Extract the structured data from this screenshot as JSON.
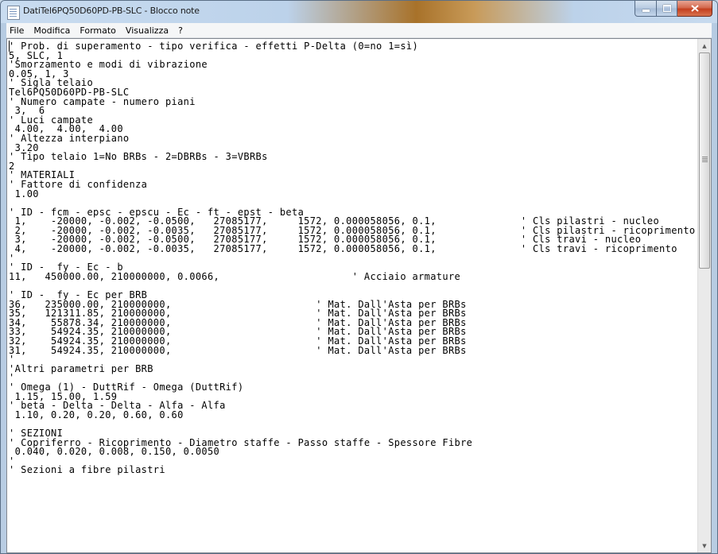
{
  "window": {
    "title": "DatiTel6PQ50D60PD-PB-SLC - Blocco note"
  },
  "menu": {
    "items": [
      "File",
      "Modifica",
      "Formato",
      "Visualizza",
      "?"
    ]
  },
  "editor": {
    "text": "' Prob. di superamento - tipo verifica - effetti P-Delta (0=no 1=sì)\n5, SLC, 1\n'Smorzamento e modi di vibrazione\n0.05, 1, 3\n' Sigla telaio\nTel6PQ50D60PD-PB-SLC\n' Numero campate - numero piani\n 3,  6\n' Luci campate\n 4.00,  4.00,  4.00\n' Altezza interpiano\n 3.20\n' Tipo telaio 1=No BRBs - 2=DBRBs - 3=VBRBs\n2\n' MATERIALI\n' Fattore di confidenza\n 1.00\n\n' ID - fcm - epsc - epscu - Ec - ft - epst - beta\n 1,    -20000, -0.002, -0.0500,   27085177,     1572, 0.000058056, 0.1,              ' Cls pilastri - nucleo\n 2,    -20000, -0.002, -0.0035,   27085177,     1572, 0.000058056, 0.1,              ' Cls pilastri - ricoprimento\n 3,    -20000, -0.002, -0.0500,   27085177,     1572, 0.000058056, 0.1,              ' Cls travi - nucleo\n 4,    -20000, -0.002, -0.0035,   27085177,     1572, 0.000058056, 0.1,              ' Cls travi - ricoprimento\n'\n' ID -  fy - Ec - b\n11,   450000.00, 210000000, 0.0066,                      ' Acciaio armature\n\n' ID -  fy - Ec per BRB\n36,   235000.00, 210000000,                        ' Mat. Dall'Asta per BRBs\n35,   121311.85, 210000000,                        ' Mat. Dall'Asta per BRBs\n34,    55878.34, 210000000,                        ' Mat. Dall'Asta per BRBs\n33,    54924.35, 210000000,                        ' Mat. Dall'Asta per BRBs\n32,    54924.35, 210000000,                        ' Mat. Dall'Asta per BRBs\n31,    54924.35, 210000000,                        ' Mat. Dall'Asta per BRBs\n'\n'Altri parametri per BRB\n'\n' Omega (1) - DuttRif - Omega (DuttRif)\n 1.15, 15.00, 1.59\n' beta - Delta - Delta - Alfa - Alfa\n 1.10, 0.20, 0.20, 0.60, 0.60\n\n' SEZIONI\n' Copriferro - Ricoprimento - Diametro staffe - Passo staffe - Spessore Fibre\n 0.040, 0.020, 0.008, 0.150, 0.0050\n'\n' Sezioni a fibre pilastri"
  },
  "icons": {
    "app": "notepad-icon",
    "minimize": "minimize-icon",
    "maximize": "maximize-icon",
    "close": "close-icon",
    "scroll_up": "chevron-up-icon",
    "scroll_down": "chevron-down-icon"
  },
  "scrollbar": {
    "position_fraction": 0.0
  }
}
